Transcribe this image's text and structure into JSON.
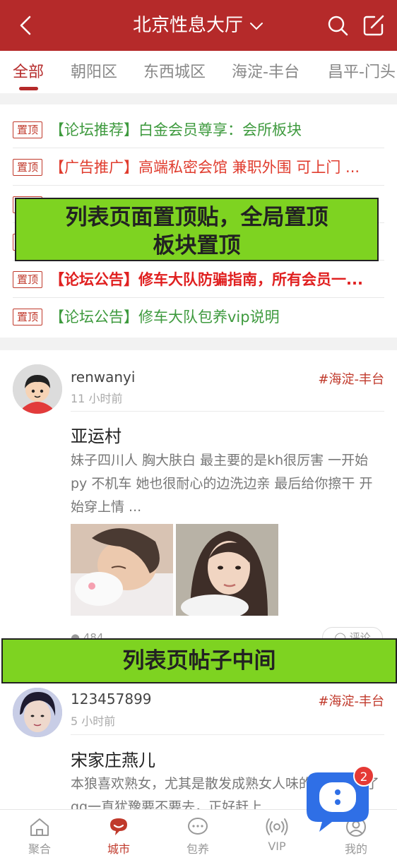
{
  "header": {
    "title": "北京性息大厅"
  },
  "tabs": [
    {
      "label": "全部"
    },
    {
      "label": "朝阳区"
    },
    {
      "label": "东西城区"
    },
    {
      "label": "海淀-丰台"
    },
    {
      "label": "昌平-门头"
    }
  ],
  "pinned": [
    {
      "badge": "置顶",
      "text": "【论坛推荐】白金会员尊享：会所板块"
    },
    {
      "badge": "置顶",
      "text": "【广告推广】高端私密会馆 兼职外围 可上门 ..."
    },
    {
      "badge": "置顶",
      "text": ""
    },
    {
      "badge": "置顶",
      "text": ""
    },
    {
      "badge": "置顶",
      "text": "【论坛公告】修车大队防骗指南，所有会员一..."
    },
    {
      "badge": "置顶",
      "text": "【论坛公告】修车大队包养vip说明"
    }
  ],
  "overlay_top": "列表页面置顶贴，全局置顶\n板块置顶",
  "overlay_mid": "列表页帖子中间",
  "posts": [
    {
      "username": "renwanyi",
      "time": "11 小时前",
      "tag": "#海淀-丰台",
      "title": "亚运村",
      "excerpt": "妹子四川人 胸大肤白 最主要的是kh很厉害 一开始py 不机车 她也很耐心的边洗边亲 最后给你擦干 开始穿上情 ...",
      "views": "484",
      "comment_label": "评论"
    },
    {
      "username": "123457899",
      "time": "5 小时前",
      "tag": "#海淀-丰台",
      "title": "宋家庄燕儿",
      "excerpt": "本狼喜欢熟女，尤其是散发成熟女人味的，之前加了qq一直犹豫要不要去，正好赶上..."
    }
  ],
  "tabbar": [
    {
      "label": "聚合"
    },
    {
      "label": "城市"
    },
    {
      "label": "包养"
    },
    {
      "label": "VIP"
    },
    {
      "label": "我的"
    }
  ],
  "fab": {
    "badge": "2"
  },
  "colors": {
    "brand": "#b52a2a",
    "overlay": "#7ed321",
    "tag": "#c0392b"
  }
}
